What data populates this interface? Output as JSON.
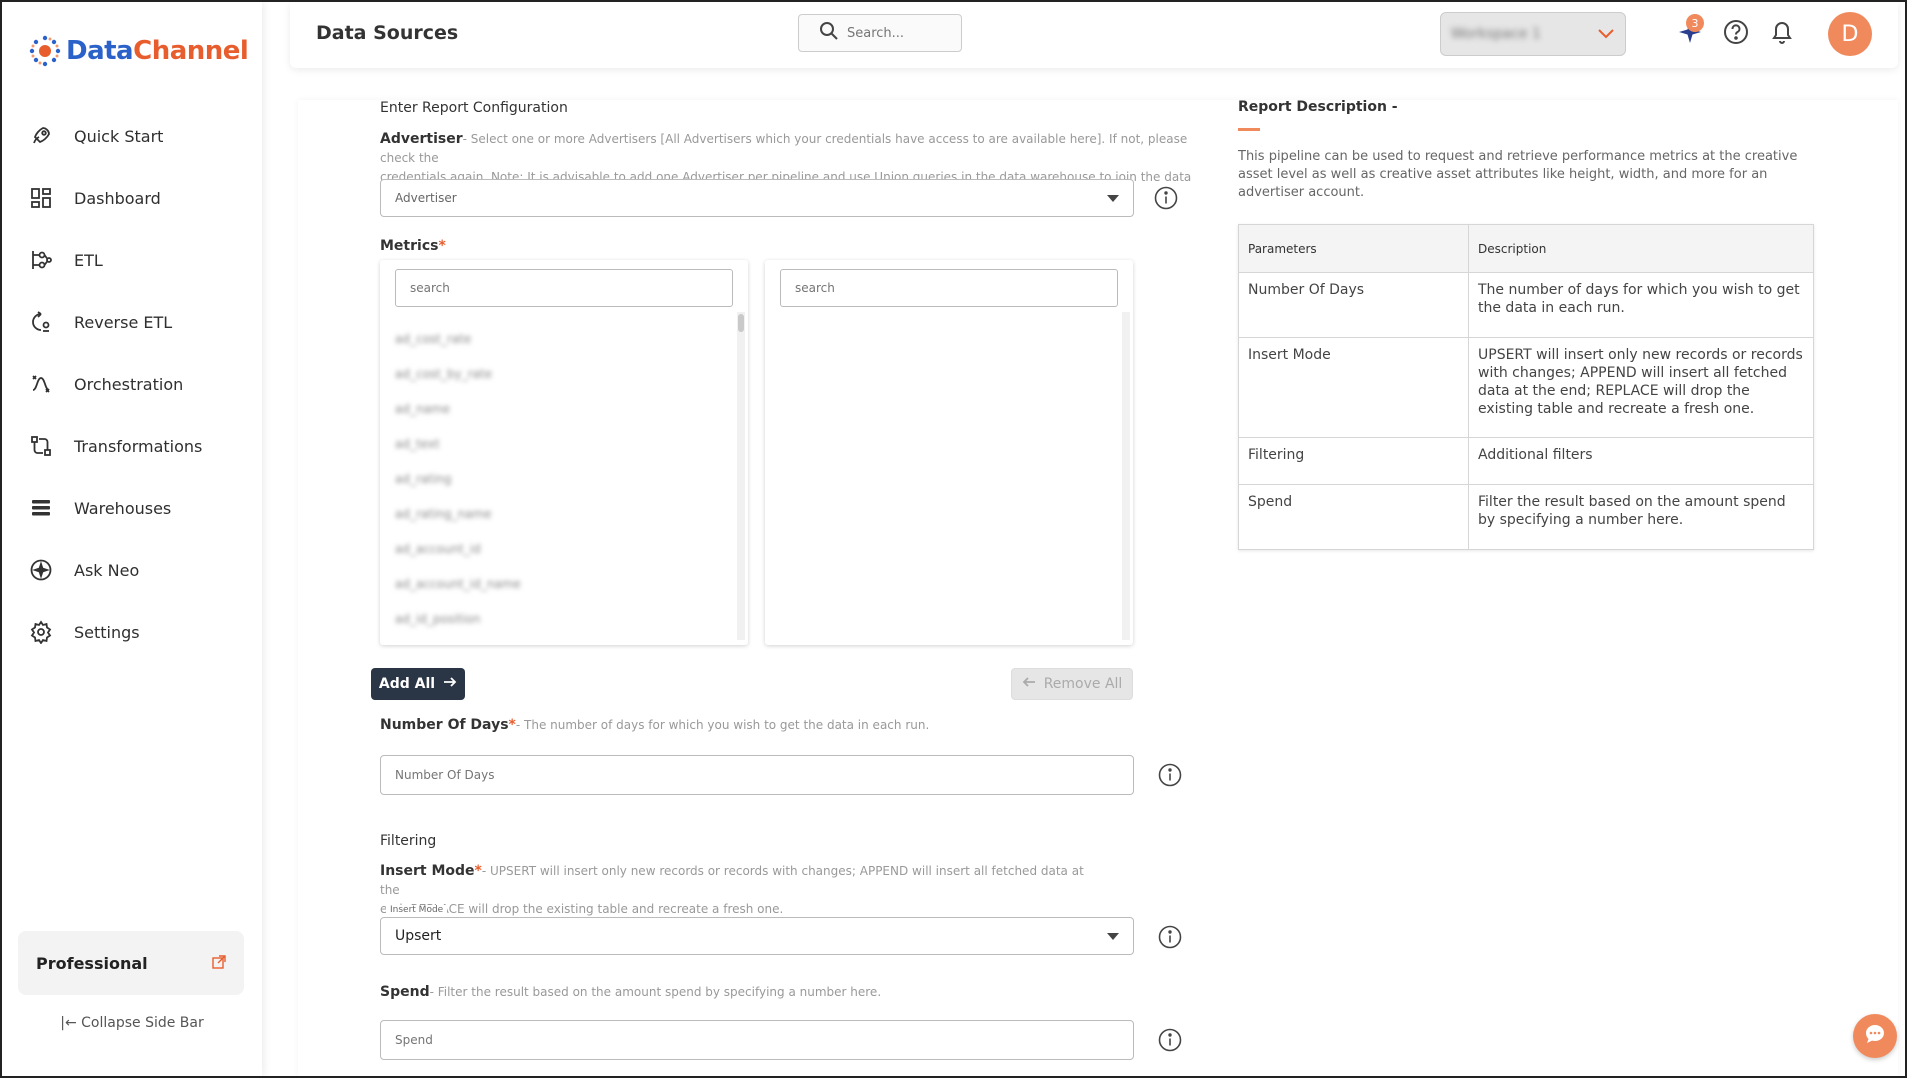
{
  "app": {
    "logo_data": "Data",
    "logo_channel": "Channel"
  },
  "sidebar": {
    "items": [
      {
        "label": "Quick Start",
        "icon": "rocket-icon"
      },
      {
        "label": "Dashboard",
        "icon": "dashboard-grid-icon"
      },
      {
        "label": "ETL",
        "icon": "etl-flow-icon"
      },
      {
        "label": "Reverse ETL",
        "icon": "reverse-etl-icon"
      },
      {
        "label": "Orchestration",
        "icon": "orchestration-icon"
      },
      {
        "label": "Transformations",
        "icon": "transformations-icon"
      },
      {
        "label": "Warehouses",
        "icon": "warehouses-icon"
      },
      {
        "label": "Ask Neo",
        "icon": "ask-neo-sparkle-icon"
      },
      {
        "label": "Settings",
        "icon": "gear-icon"
      }
    ],
    "plan": "Professional",
    "collapse_label": "Collapse Side Bar"
  },
  "header": {
    "title": "Data Sources",
    "search_placeholder": "Search...",
    "account_name": "Workspace 1",
    "notification_count": "3",
    "avatar_initial": "D"
  },
  "form": {
    "section_title": "Enter Report Configuration",
    "advertiser": {
      "label": "Advertiser",
      "desc_line1": "- Select one or more Advertisers [All Advertisers which your credentials have access to are available here]. If not, please check the",
      "desc_line2": "credentials again. Note: It is advisable to add one Advertiser per pipeline and use Union queries in the data warehouse to join the data for...",
      "placeholder": "Advertiser"
    },
    "metrics": {
      "label": "Metrics",
      "left_search_placeholder": "search",
      "right_search_placeholder": "search",
      "items": [
        "ad_cost_rate",
        "ad_cost_by_rate",
        "ad_name",
        "ad_text",
        "ad_rating",
        "ad_rating_name",
        "ad_account_id",
        "ad_account_id_name",
        "ad_id_position"
      ],
      "add_all": "Add All",
      "remove_all": "Remove All"
    },
    "days": {
      "label": "Number Of Days",
      "desc": "- The number of days for which you wish to get the data in each run.",
      "placeholder": "Number Of Days"
    },
    "filtering_title": "Filtering",
    "insert_mode": {
      "label": "Insert Mode",
      "desc_line1": "- UPSERT will insert only new records or records with changes; APPEND will insert all fetched data at the",
      "desc_line2": "end; REPLACE will drop the existing table and recreate a fresh one.",
      "floating_label": "Insert Mode",
      "value": "Upsert"
    },
    "spend": {
      "label": "Spend",
      "desc": "- Filter the result based on the amount spend by specifying a number here.",
      "placeholder": "Spend"
    }
  },
  "report_description": {
    "title": "Report Description -",
    "text": "This pipeline can be used to request and retrieve performance metrics at the creative asset level as well as creative asset attributes like height, width, and more for an advertiser account.",
    "headers": [
      "Parameters",
      "Description"
    ],
    "rows": [
      {
        "param": "Number Of Days",
        "desc": "The number of days for which you wish to get the data in each run."
      },
      {
        "param": "Insert Mode",
        "desc": "UPSERT will insert only new records or records with changes; APPEND will insert all fetched data at the end; REPLACE will drop the existing table and recreate a fresh one."
      },
      {
        "param": "Filtering",
        "desc": "Additional filters"
      },
      {
        "param": "Spend",
        "desc": "Filter the result based on the amount spend by specifying a number here."
      }
    ]
  },
  "colors": {
    "accent": "#f08a5d",
    "brand_blue": "#2b62c9",
    "dark_button": "#2a3645"
  }
}
